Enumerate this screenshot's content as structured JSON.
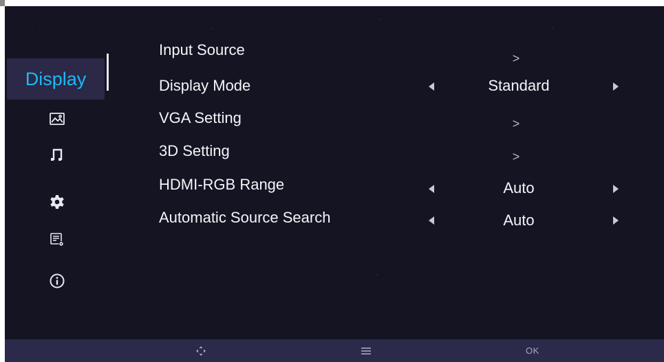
{
  "sidebar": {
    "active_label": "Display",
    "icons": [
      "picture-icon",
      "music-note-icon",
      "gear-icon",
      "settings-list-icon",
      "info-icon"
    ]
  },
  "menu": {
    "items": [
      {
        "label": "Input Source",
        "type": "submenu",
        "indicator": ">"
      },
      {
        "label": "Display Mode",
        "type": "selector",
        "value": "Standard"
      },
      {
        "label": "VGA Setting",
        "type": "submenu",
        "indicator": ">"
      },
      {
        "label": "3D Setting",
        "type": "submenu",
        "indicator": ">"
      },
      {
        "label": "HDMI-RGB Range",
        "type": "selector",
        "value": "Auto"
      },
      {
        "label": "Automatic Source Search",
        "type": "selector",
        "value": "Auto"
      }
    ]
  },
  "bottom_bar": {
    "hints": [
      "move-icon",
      "menu-icon"
    ],
    "ok_label": "OK"
  },
  "colors": {
    "background": "#151423",
    "active_text": "#1fb8f2",
    "highlight": "#2b2848",
    "bottom_bar": "#2c2a4a"
  }
}
